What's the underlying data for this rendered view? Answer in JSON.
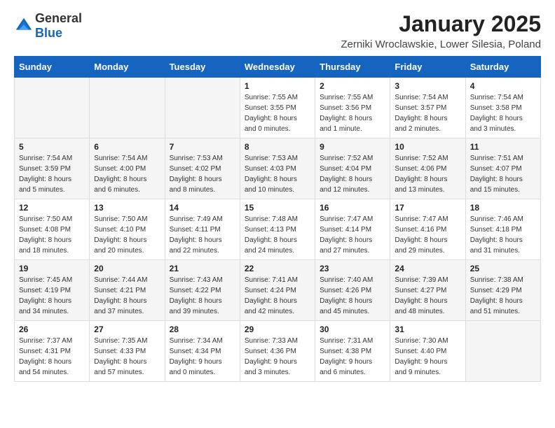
{
  "header": {
    "logo_general": "General",
    "logo_blue": "Blue",
    "title": "January 2025",
    "subtitle": "Zerniki Wroclawskie, Lower Silesia, Poland"
  },
  "calendar": {
    "weekdays": [
      "Sunday",
      "Monday",
      "Tuesday",
      "Wednesday",
      "Thursday",
      "Friday",
      "Saturday"
    ],
    "weeks": [
      [
        {
          "day": "",
          "info": ""
        },
        {
          "day": "",
          "info": ""
        },
        {
          "day": "",
          "info": ""
        },
        {
          "day": "1",
          "info": "Sunrise: 7:55 AM\nSunset: 3:55 PM\nDaylight: 8 hours\nand 0 minutes."
        },
        {
          "day": "2",
          "info": "Sunrise: 7:55 AM\nSunset: 3:56 PM\nDaylight: 8 hours\nand 1 minute."
        },
        {
          "day": "3",
          "info": "Sunrise: 7:54 AM\nSunset: 3:57 PM\nDaylight: 8 hours\nand 2 minutes."
        },
        {
          "day": "4",
          "info": "Sunrise: 7:54 AM\nSunset: 3:58 PM\nDaylight: 8 hours\nand 3 minutes."
        }
      ],
      [
        {
          "day": "5",
          "info": "Sunrise: 7:54 AM\nSunset: 3:59 PM\nDaylight: 8 hours\nand 5 minutes."
        },
        {
          "day": "6",
          "info": "Sunrise: 7:54 AM\nSunset: 4:00 PM\nDaylight: 8 hours\nand 6 minutes."
        },
        {
          "day": "7",
          "info": "Sunrise: 7:53 AM\nSunset: 4:02 PM\nDaylight: 8 hours\nand 8 minutes."
        },
        {
          "day": "8",
          "info": "Sunrise: 7:53 AM\nSunset: 4:03 PM\nDaylight: 8 hours\nand 10 minutes."
        },
        {
          "day": "9",
          "info": "Sunrise: 7:52 AM\nSunset: 4:04 PM\nDaylight: 8 hours\nand 12 minutes."
        },
        {
          "day": "10",
          "info": "Sunrise: 7:52 AM\nSunset: 4:06 PM\nDaylight: 8 hours\nand 13 minutes."
        },
        {
          "day": "11",
          "info": "Sunrise: 7:51 AM\nSunset: 4:07 PM\nDaylight: 8 hours\nand 15 minutes."
        }
      ],
      [
        {
          "day": "12",
          "info": "Sunrise: 7:50 AM\nSunset: 4:08 PM\nDaylight: 8 hours\nand 18 minutes."
        },
        {
          "day": "13",
          "info": "Sunrise: 7:50 AM\nSunset: 4:10 PM\nDaylight: 8 hours\nand 20 minutes."
        },
        {
          "day": "14",
          "info": "Sunrise: 7:49 AM\nSunset: 4:11 PM\nDaylight: 8 hours\nand 22 minutes."
        },
        {
          "day": "15",
          "info": "Sunrise: 7:48 AM\nSunset: 4:13 PM\nDaylight: 8 hours\nand 24 minutes."
        },
        {
          "day": "16",
          "info": "Sunrise: 7:47 AM\nSunset: 4:14 PM\nDaylight: 8 hours\nand 27 minutes."
        },
        {
          "day": "17",
          "info": "Sunrise: 7:47 AM\nSunset: 4:16 PM\nDaylight: 8 hours\nand 29 minutes."
        },
        {
          "day": "18",
          "info": "Sunrise: 7:46 AM\nSunset: 4:18 PM\nDaylight: 8 hours\nand 31 minutes."
        }
      ],
      [
        {
          "day": "19",
          "info": "Sunrise: 7:45 AM\nSunset: 4:19 PM\nDaylight: 8 hours\nand 34 minutes."
        },
        {
          "day": "20",
          "info": "Sunrise: 7:44 AM\nSunset: 4:21 PM\nDaylight: 8 hours\nand 37 minutes."
        },
        {
          "day": "21",
          "info": "Sunrise: 7:43 AM\nSunset: 4:22 PM\nDaylight: 8 hours\nand 39 minutes."
        },
        {
          "day": "22",
          "info": "Sunrise: 7:41 AM\nSunset: 4:24 PM\nDaylight: 8 hours\nand 42 minutes."
        },
        {
          "day": "23",
          "info": "Sunrise: 7:40 AM\nSunset: 4:26 PM\nDaylight: 8 hours\nand 45 minutes."
        },
        {
          "day": "24",
          "info": "Sunrise: 7:39 AM\nSunset: 4:27 PM\nDaylight: 8 hours\nand 48 minutes."
        },
        {
          "day": "25",
          "info": "Sunrise: 7:38 AM\nSunset: 4:29 PM\nDaylight: 8 hours\nand 51 minutes."
        }
      ],
      [
        {
          "day": "26",
          "info": "Sunrise: 7:37 AM\nSunset: 4:31 PM\nDaylight: 8 hours\nand 54 minutes."
        },
        {
          "day": "27",
          "info": "Sunrise: 7:35 AM\nSunset: 4:33 PM\nDaylight: 8 hours\nand 57 minutes."
        },
        {
          "day": "28",
          "info": "Sunrise: 7:34 AM\nSunset: 4:34 PM\nDaylight: 9 hours\nand 0 minutes."
        },
        {
          "day": "29",
          "info": "Sunrise: 7:33 AM\nSunset: 4:36 PM\nDaylight: 9 hours\nand 3 minutes."
        },
        {
          "day": "30",
          "info": "Sunrise: 7:31 AM\nSunset: 4:38 PM\nDaylight: 9 hours\nand 6 minutes."
        },
        {
          "day": "31",
          "info": "Sunrise: 7:30 AM\nSunset: 4:40 PM\nDaylight: 9 hours\nand 9 minutes."
        },
        {
          "day": "",
          "info": ""
        }
      ]
    ]
  }
}
